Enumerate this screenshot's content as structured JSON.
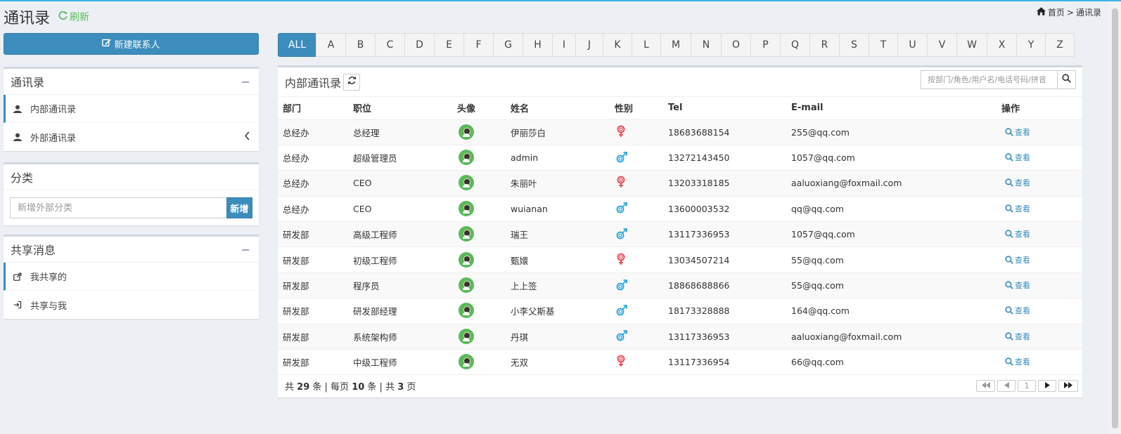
{
  "header": {
    "title": "通讯录",
    "refresh_label": "刷新",
    "breadcrumb_home": "首页",
    "breadcrumb_sep": ">",
    "breadcrumb_current": "通讯录"
  },
  "sidebar": {
    "new_contact_label": "新建联系人",
    "contacts_box": {
      "title": "通讯录",
      "items": [
        {
          "label": "内部通讯录",
          "icon": "user-icon",
          "active": true
        },
        {
          "label": "外部通讯录",
          "icon": "user-icon",
          "active": false
        }
      ]
    },
    "category_box": {
      "title": "分类",
      "input_placeholder": "新增外部分类",
      "add_label": "新增"
    },
    "share_box": {
      "title": "共享消息",
      "items": [
        {
          "label": "我共享的",
          "icon": "share-icon",
          "active": true
        },
        {
          "label": "共享与我",
          "icon": "sign-in-icon",
          "active": false
        }
      ]
    }
  },
  "letters": [
    "ALL",
    "A",
    "B",
    "C",
    "D",
    "E",
    "F",
    "G",
    "H",
    "I",
    "J",
    "K",
    "L",
    "M",
    "N",
    "O",
    "P",
    "Q",
    "R",
    "S",
    "T",
    "U",
    "V",
    "W",
    "X",
    "Y",
    "Z"
  ],
  "active_letter": "ALL",
  "panel": {
    "title": "内部通讯录",
    "search_placeholder": "按部门/角色/用户名/电话号码/拼音",
    "columns": [
      "部门",
      "职位",
      "头像",
      "姓名",
      "性别",
      "Tel",
      "E-mail",
      "操作"
    ],
    "view_label": "查看",
    "rows": [
      {
        "dept": "总经办",
        "position": "总经理",
        "name": "伊丽莎白",
        "gender": "female",
        "tel": "18683688154",
        "email": "255@qq.com"
      },
      {
        "dept": "总经办",
        "position": "超级管理员",
        "name": "admin",
        "gender": "male",
        "tel": "13272143450",
        "email": "1057@qq.com"
      },
      {
        "dept": "总经办",
        "position": "CEO",
        "name": "朱丽叶",
        "gender": "female",
        "tel": "13203318185",
        "email": "aaluoxiang@foxmail.com"
      },
      {
        "dept": "总经办",
        "position": "CEO",
        "name": "wuianan",
        "gender": "male",
        "tel": "13600003532",
        "email": "qq@qq.com"
      },
      {
        "dept": "研发部",
        "position": "高级工程师",
        "name": "瑞王",
        "gender": "male",
        "tel": "13117336953",
        "email": "1057@qq.com"
      },
      {
        "dept": "研发部",
        "position": "初级工程师",
        "name": "甄嬛",
        "gender": "female",
        "tel": "13034507214",
        "email": "55@qq.com"
      },
      {
        "dept": "研发部",
        "position": "程序员",
        "name": "上上签",
        "gender": "male",
        "tel": "18868688866",
        "email": "55@qq.com"
      },
      {
        "dept": "研发部",
        "position": "研发部经理",
        "name": "小李父斯基",
        "gender": "male",
        "tel": "18173328888",
        "email": "164@qq.com"
      },
      {
        "dept": "研发部",
        "position": "系统架构师",
        "name": "丹琪",
        "gender": "male",
        "tel": "13117336953",
        "email": "aaluoxiang@foxmail.com"
      },
      {
        "dept": "研发部",
        "position": "中级工程师",
        "name": "无双",
        "gender": "female",
        "tel": "13117336954",
        "email": "66@qq.com"
      }
    ]
  },
  "footer": {
    "total_prefix": "共",
    "total": "29",
    "total_suffix": "条 | 每页",
    "per_page": "10",
    "per_page_suffix": "条 | 共",
    "pages": "3",
    "pages_suffix": "页",
    "current_page": "1"
  },
  "colors": {
    "primary": "#3c8dbc",
    "refresh_green": "#5cb85c",
    "female": "#e8454f",
    "male": "#2aa4d9",
    "avatar_bg": "#5cb85c"
  }
}
